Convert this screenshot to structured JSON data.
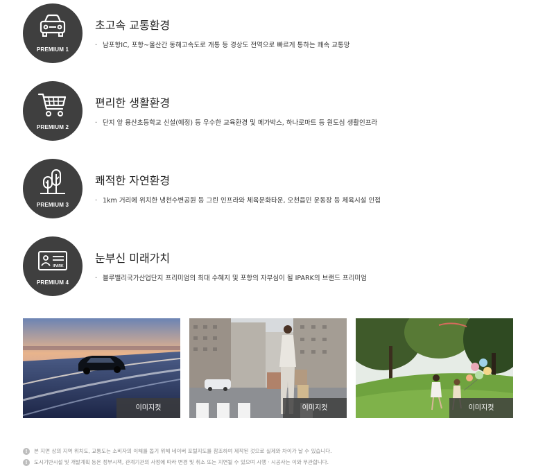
{
  "features": [
    {
      "badge": "PREMIUM 1",
      "icon": "car-icon",
      "title": "초고속 교통환경",
      "desc": "남포항IC, 포항~울산간 동해고속도로 개통 등 경상도 전역으로 빠르게 통하는 쾌속 교통망"
    },
    {
      "badge": "PREMIUM 2",
      "icon": "shopping-cart-icon",
      "title": "편리한 생활환경",
      "desc": "단지 앞 용산초등학교 신설(예정) 등 우수한 교육환경 및 메가박스, 하나로마트 등 원도심 생활인프라"
    },
    {
      "badge": "PREMIUM 3",
      "icon": "trees-icon",
      "title": "쾌적한 자연환경",
      "desc": "1km 거리에 위치한 냉천수변공원 등 그린 인프라와 체육문화타운, 오천읍민 운동장 등 체육시설 인접"
    },
    {
      "badge": "PREMIUM 4",
      "icon": "ipark-card-icon",
      "title": "눈부신 미래가치",
      "desc": "블루밸리국가산업단지 프리미엄의 최대 수혜지 및 포항의 자부심이 될 IPARK의 브랜드 프리미엄",
      "icon_text": "IPARK"
    }
  ],
  "bullet": "·",
  "photos": [
    {
      "caption": "이미지컷"
    },
    {
      "caption": "이미지컷"
    },
    {
      "caption": "이미지컷"
    }
  ],
  "notes": [
    "본 지면 상의 지역 위치도, 교통도는 소비자의 이해를 돕기 위해 네이버 포털지도를 참조하여 제작된 것으로 실제와 차이가 날 수 있습니다.",
    "도시기반시설 및 개발계획 등은 정부시책, 관계기관의 사정에 따라 변경 및 취소 또는 지연될 수 있으며 시행 · 시공사는 이와 무관합니다."
  ],
  "note_icon": "!"
}
